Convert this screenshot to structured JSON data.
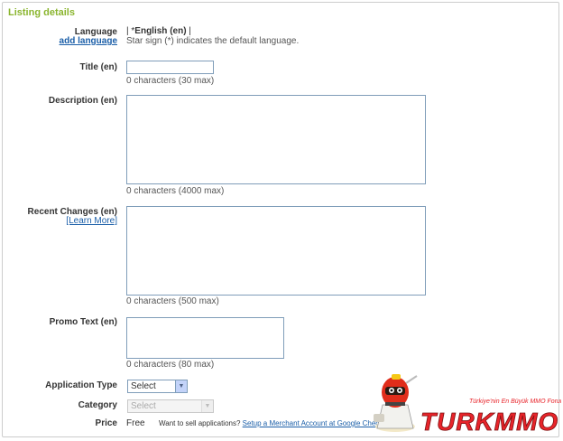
{
  "section_title": "Listing details",
  "language": {
    "label": "Language",
    "add_link": "add language",
    "value_prefix": "| ",
    "star": "*",
    "value": "English (en)",
    "value_suffix": " |",
    "note": "Star sign (*) indicates the default language."
  },
  "title": {
    "label": "Title (en)",
    "value": "",
    "counter": "0 characters (30 max)"
  },
  "description": {
    "label": "Description (en)",
    "value": "",
    "counter": "0 characters (4000 max)"
  },
  "recent_changes": {
    "label": "Recent Changes (en)",
    "learn_more": "[Learn More]",
    "value": "",
    "counter": "0 characters (500 max)"
  },
  "promo_text": {
    "label": "Promo Text (en)",
    "value": "",
    "counter": "0 characters (80 max)"
  },
  "application_type": {
    "label": "Application Type",
    "selected": "Select"
  },
  "category": {
    "label": "Category",
    "selected": "Select"
  },
  "price": {
    "label": "Price",
    "value": "Free",
    "note": "Want to sell applications?",
    "link": "Setup a Merchant Account at Google Checkout"
  },
  "watermark": {
    "tagline": "Türkiye'nin En Büyük MMO Forumu",
    "brand": "TURKMMO"
  },
  "colors": {
    "section_title": "#8ab52e",
    "link": "#1a5ea8",
    "input_border": "#7f9db9",
    "brand_red": "#e8242a"
  }
}
